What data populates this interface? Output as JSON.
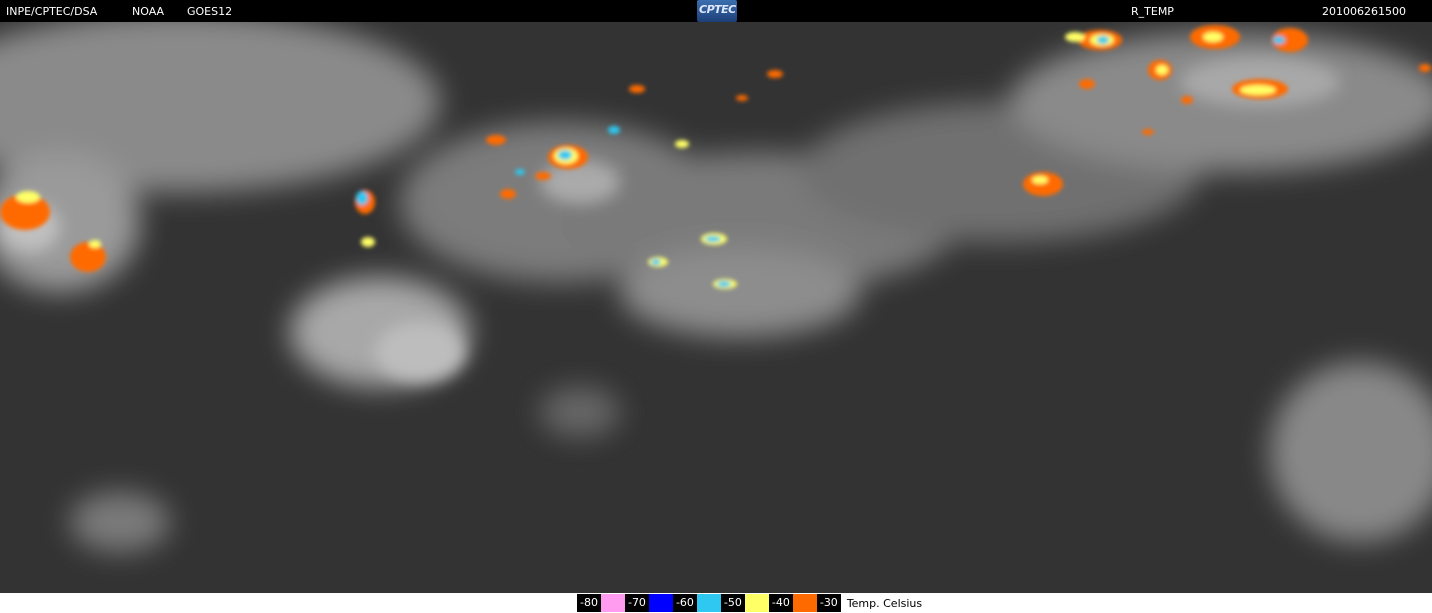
{
  "header": {
    "source": "INPE/CPTEC/DSA",
    "agency": "NOAA",
    "satellite": "GOES12",
    "logo_text": "CPTEC",
    "product": "R_TEMP",
    "timestamp": "201006261500"
  },
  "legend": {
    "items": [
      {
        "label": "-80",
        "color": "#ff9cf0"
      },
      {
        "label": "-70",
        "color": "#0000ff"
      },
      {
        "label": "-60",
        "color": "#2ec8f0"
      },
      {
        "label": "-50",
        "color": "#ffff66"
      },
      {
        "label": "-40",
        "color": "#ff6a00"
      },
      {
        "label": "-30"
      }
    ],
    "units": "Temp. Celsius"
  },
  "map_icon": "satellite-infrared-image"
}
